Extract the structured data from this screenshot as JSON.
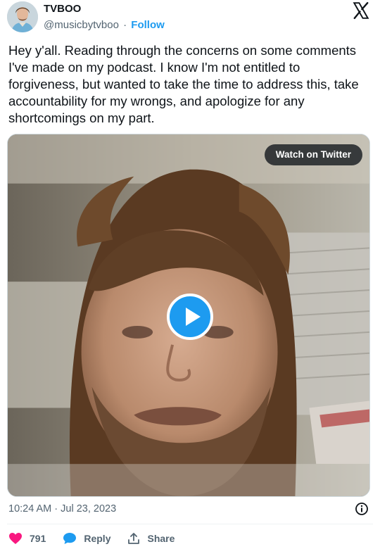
{
  "tweet": {
    "author": {
      "display_name": "TVBOO",
      "handle": "@musicbytvboo",
      "separator": "·",
      "follow_label": "Follow"
    },
    "text": "Hey y'all. Reading through the concerns on some comments I've made on my podcast. I know I'm not entitled to forgiveness, but wanted to take the time to address this, take accountability for my wrongs, and apologize for any shortcomings on my part.",
    "media": {
      "watch_label": "Watch on Twitter",
      "play_icon": "play-icon"
    },
    "timestamp": "10:24 AM · Jul 23, 2023",
    "actions": {
      "like_count": "791",
      "reply_label": "Reply",
      "share_label": "Share"
    }
  },
  "colors": {
    "accent": "#1d9bf0",
    "like": "#f91880",
    "muted": "#536471",
    "text": "#0f1419"
  }
}
